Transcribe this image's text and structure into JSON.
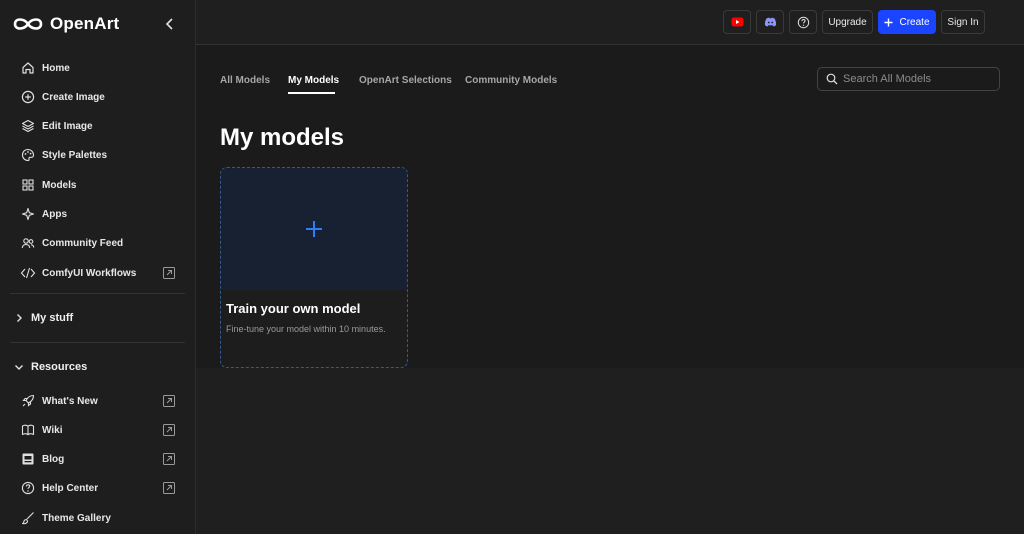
{
  "brand": {
    "name": "OpenArt"
  },
  "sidebar": {
    "nav": [
      {
        "label": "Home",
        "icon": "home-icon"
      },
      {
        "label": "Create Image",
        "icon": "plus-circle-icon"
      },
      {
        "label": "Edit Image",
        "icon": "layers-icon"
      },
      {
        "label": "Style Palettes",
        "icon": "palette-icon"
      },
      {
        "label": "Models",
        "icon": "grid-icon"
      },
      {
        "label": "Apps",
        "icon": "sparkle-icon"
      },
      {
        "label": "Community Feed",
        "icon": "users-icon"
      },
      {
        "label": "ComfyUI Workflows",
        "icon": "code-icon",
        "external": true
      }
    ],
    "my_stuff": "My stuff",
    "resources": "Resources",
    "resource_items": [
      {
        "label": "What's New",
        "icon": "rocket-icon",
        "external": true
      },
      {
        "label": "Wiki",
        "icon": "book-icon",
        "external": true
      },
      {
        "label": "Blog",
        "icon": "blog-icon",
        "external": true
      },
      {
        "label": "Help Center",
        "icon": "help-icon",
        "external": true
      },
      {
        "label": "Theme Gallery",
        "icon": "brush-icon"
      }
    ]
  },
  "topbar": {
    "upgrade": "Upgrade",
    "create": "Create",
    "sign_in": "Sign In",
    "youtube_color": "#ff0000",
    "discord_color": "#8a95ff"
  },
  "tabs": [
    "All Models",
    "My Models",
    "OpenArt Selections",
    "Community Models"
  ],
  "active_tab": "My Models",
  "search": {
    "placeholder": "Search All Models"
  },
  "page_title": "My models",
  "card": {
    "title": "Train your own model",
    "subtitle": "Fine-tune your model within 10 minutes."
  },
  "colors": {
    "accent": "#1a44ff",
    "plus": "#2f7dff"
  }
}
